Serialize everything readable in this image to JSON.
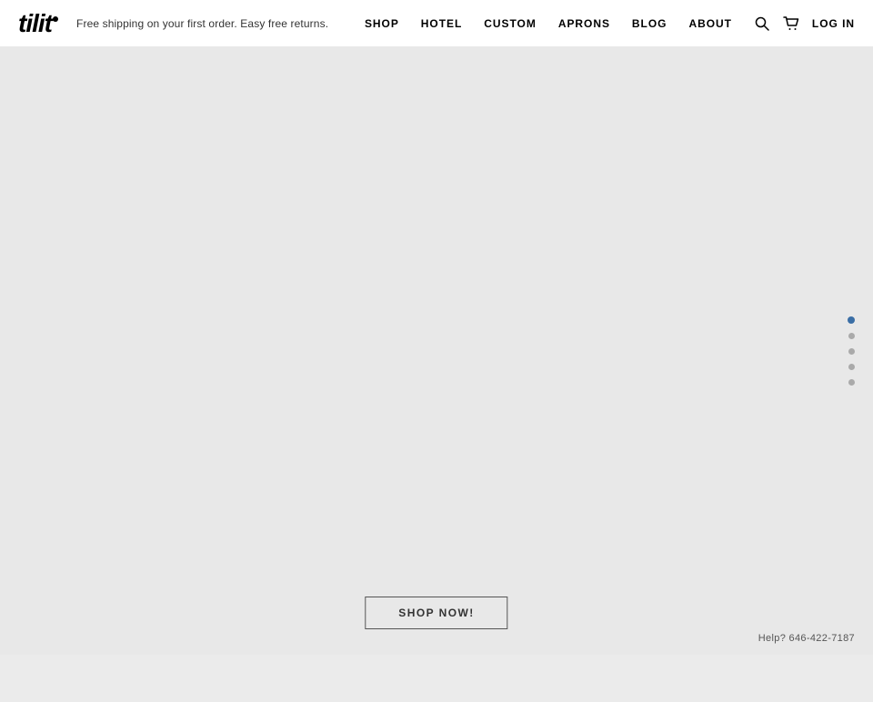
{
  "header": {
    "logo_text": "tilit",
    "tagline": "Free shipping on your first order. Easy free returns.",
    "nav_items": [
      {
        "label": "SHOP",
        "id": "shop"
      },
      {
        "label": "HOTEL",
        "id": "hotel"
      },
      {
        "label": "CUSTOM",
        "id": "custom"
      },
      {
        "label": "APRONS",
        "id": "aprons"
      },
      {
        "label": "BLOG",
        "id": "blog"
      },
      {
        "label": "ABOUT",
        "id": "about"
      },
      {
        "label": "LOG IN",
        "id": "login"
      }
    ]
  },
  "main": {
    "background_color": "#e8e8e8",
    "shop_now_label": "SHOP NOW!",
    "help_text": "Help? 646-422-7187",
    "slide_dots": [
      {
        "active": true
      },
      {
        "active": false
      },
      {
        "active": false
      },
      {
        "active": false
      },
      {
        "active": false
      }
    ]
  }
}
